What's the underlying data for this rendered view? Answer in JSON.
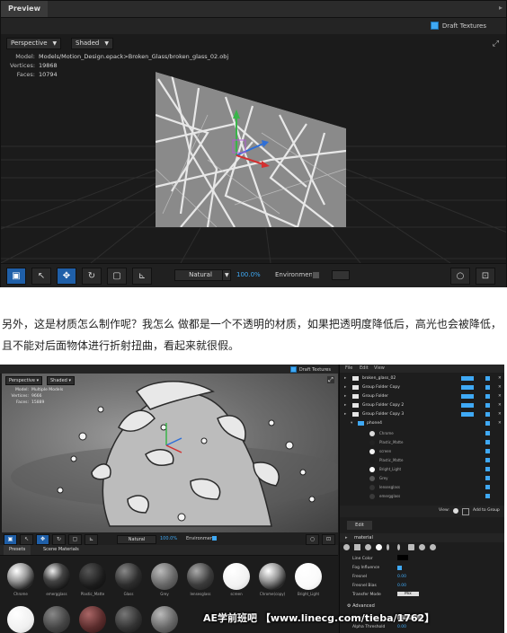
{
  "preview1": {
    "tab_title": "Preview",
    "draft_textures_label": "Draft Textures",
    "view_mode": "Perspective",
    "shading_mode": "Shaded",
    "model_info": {
      "model_key": "Model:",
      "model_value": "Models/Motion_Design.epack>Broken_Glass/broken_glass_02.obj",
      "vertices_key": "Vertices:",
      "vertices_value": "19868",
      "faces_key": "Faces:",
      "faces_value": "10794"
    },
    "bottom_bar": {
      "lighting": "Natural",
      "zoom": "100.0%",
      "environment_label": "Environment"
    }
  },
  "paragraph": "另外，这是材质怎么制作呢？我怎么 做都是一个不透明的材质，如果把透明度降低后，高光也会被降低，且不能对后面物体进行折射扭曲，看起来就很假。",
  "preview2": {
    "draft_textures_label": "Draft Textures",
    "view_mode": "Perspective",
    "shading_mode": "Shaded",
    "model_info": {
      "model_key": "Model:",
      "model_value": "Multiple Models",
      "vertices_key": "Vertices:",
      "vertices_value": "9666",
      "faces_key": "Faces:",
      "faces_value": "15889"
    },
    "bottom_bar": {
      "lighting": "Natural",
      "zoom": "100.0%",
      "environment_label": "Environment"
    },
    "presets_tabs": [
      "Presets",
      "Scene Materials"
    ],
    "materials_row1": [
      "Chrome",
      "emergglass",
      "Plastic_Matte",
      "Glass",
      "Grey",
      "lensesglass",
      "screen",
      "Chrome(copy)",
      "Bright_Light"
    ],
    "menu": [
      "File",
      "Edit",
      "View"
    ],
    "layers": [
      {
        "name": "broken_glass_02"
      },
      {
        "name": "Group Folder Copy"
      },
      {
        "name": "Group Folder"
      },
      {
        "name": "Group Folder Copy 2"
      },
      {
        "name": "Group Folder Copy 3"
      },
      {
        "name": "phone4"
      }
    ],
    "sublayers": [
      {
        "name": "Chrome",
        "color": "#d9d9d9"
      },
      {
        "name": "Plastic_Matte",
        "color": "#222222"
      },
      {
        "name": "screen",
        "color": "#f2f2f2"
      },
      {
        "name": "Plastic_Matte",
        "color": "#1b1b1b"
      },
      {
        "name": "Bright_Light",
        "color": "#ffffff"
      },
      {
        "name": "Grey",
        "color": "#555555"
      },
      {
        "name": "lensesglass",
        "color": "#333333"
      },
      {
        "name": "emergglass",
        "color": "#3a3a3a"
      }
    ],
    "view_label": "View:",
    "add_to_group": "Add to Group",
    "edit_tab": "Edit",
    "material_label": "material",
    "properties": [
      {
        "k": "Line Color",
        "v": ""
      },
      {
        "k": "Fog Influence",
        "v": ""
      },
      {
        "k": "Fresnel",
        "v": "0.00"
      },
      {
        "k": "Fresnel Bias",
        "v": "0.00"
      },
      {
        "k": "Transfer Mode",
        "v": "Mix"
      }
    ],
    "advanced_label": "Advanced",
    "blend_mode_label": "Blend Mode",
    "blend_mode_value": "Normal",
    "alpha_threshold_label": "Alpha Threshold",
    "alpha_threshold_value": "0.00"
  },
  "watermark": "AE学前班吧 【www.linecg.com/tieba/1762】",
  "colors": {
    "accent": "#3fa9f5",
    "active_button": "#1f5fa8",
    "panel_bg": "#1e1e1e"
  }
}
